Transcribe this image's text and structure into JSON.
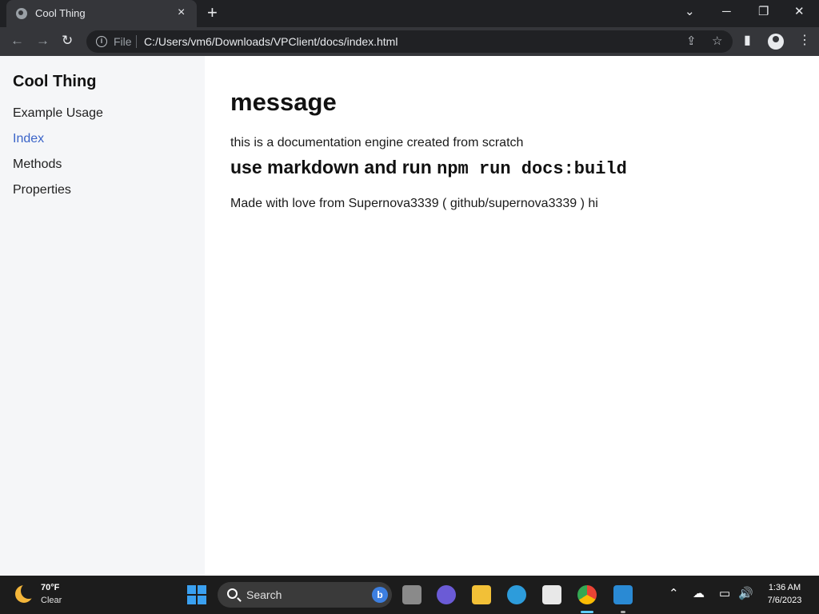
{
  "browser": {
    "tab_title": "Cool Thing",
    "tab_close": "×",
    "new_tab": "+",
    "omnibox": {
      "scheme_label": "File",
      "url": "C:/Users/vm6/Downloads/VPClient/docs/index.html"
    }
  },
  "sidebar": {
    "title": "Cool Thing",
    "items": [
      {
        "label": "Example Usage",
        "current": false
      },
      {
        "label": "Index",
        "current": true
      },
      {
        "label": "Methods",
        "current": false
      },
      {
        "label": "Properties",
        "current": false
      }
    ],
    "current_color": "#3b64c8"
  },
  "content": {
    "heading": "message",
    "paragraph": "this is a documentation engine created from scratch",
    "subheading_text": "use markdown and run ",
    "subheading_code": "npm run docs:build",
    "footer_text": "Made with love from Supernova3339 ( github/supernova3339 ) hi"
  },
  "taskbar": {
    "weather": {
      "temp": "70°F",
      "condition": "Clear",
      "icon": "moon-icon"
    },
    "search_placeholder": "Search",
    "bing_label": "b",
    "clock": {
      "time": "1:36 AM",
      "date": "7/6/2023"
    }
  }
}
